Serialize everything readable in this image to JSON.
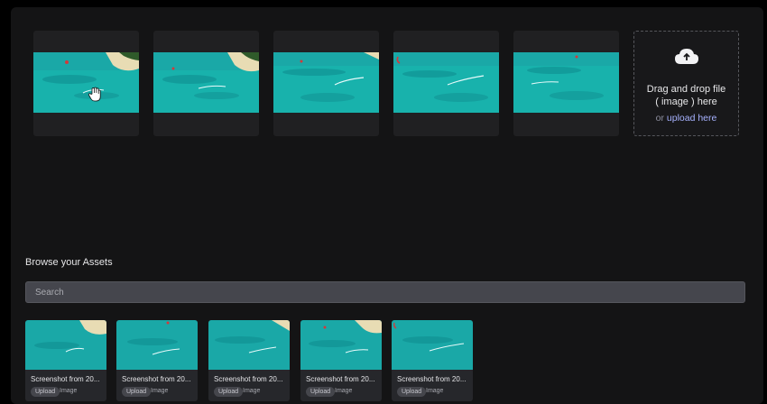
{
  "slots": [
    {
      "id": "slot-1",
      "variant": "a"
    },
    {
      "id": "slot-2",
      "variant": "a"
    },
    {
      "id": "slot-3",
      "variant": "b"
    },
    {
      "id": "slot-4",
      "variant": "c"
    },
    {
      "id": "slot-5",
      "variant": "d"
    }
  ],
  "dropzone": {
    "line1": "Drag and drop file",
    "line2": "( image ) here",
    "or_text": "or",
    "link_text": "upload here",
    "icon": "cloud-upload-icon"
  },
  "assets": {
    "title": "Browse your Assets",
    "search_placeholder": "Search",
    "items": [
      {
        "name": "Screenshot from 20...",
        "tag": "Upload",
        "kind": "Image"
      },
      {
        "name": "Screenshot from 20...",
        "tag": "Upload",
        "kind": "Image"
      },
      {
        "name": "Screenshot from 20...",
        "tag": "Upload",
        "kind": "Image"
      },
      {
        "name": "Screenshot from 20...",
        "tag": "Upload",
        "kind": "Image"
      },
      {
        "name": "Screenshot from 20...",
        "tag": "Upload",
        "kind": "Image"
      }
    ]
  },
  "colors": {
    "panel": "#141415",
    "accent_link": "#a7b2ff",
    "water": "#19b5b0",
    "sand": "#e9dfb8"
  },
  "cursor_icon": "hand-cursor-icon"
}
